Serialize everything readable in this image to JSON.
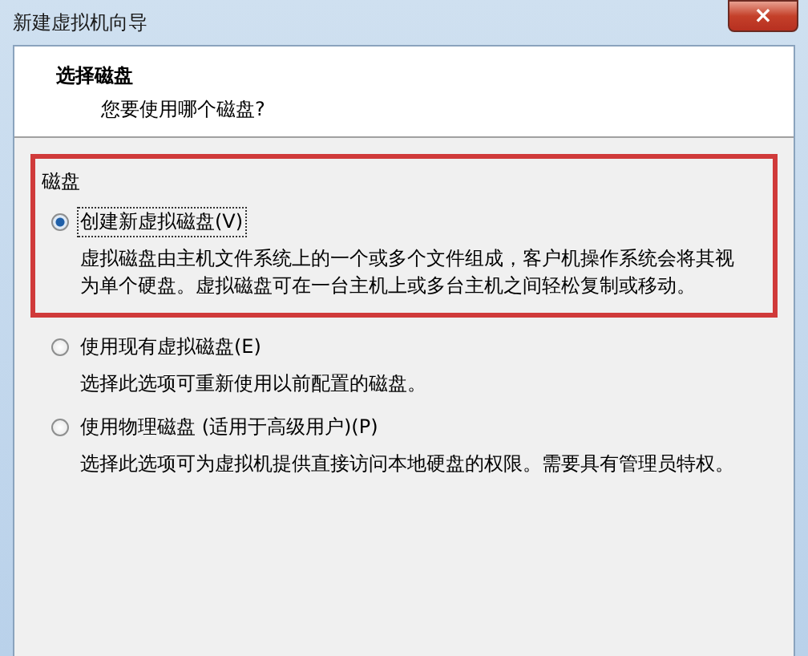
{
  "window": {
    "title": "新建虚拟机向导",
    "close": "×"
  },
  "header": {
    "title": "选择磁盘",
    "subtitle": "您要使用哪个磁盘?"
  },
  "group": {
    "label": "磁盘",
    "highlighted": true
  },
  "options": [
    {
      "label": "创建新虚拟磁盘(V)",
      "description": "虚拟磁盘由主机文件系统上的一个或多个文件组成，客户机操作系统会将其视为单个硬盘。虚拟磁盘可在一台主机上或多台主机之间轻松复制或移动。",
      "selected": true
    },
    {
      "label": "使用现有虚拟磁盘(E)",
      "description": "选择此选项可重新使用以前配置的磁盘。",
      "selected": false
    },
    {
      "label": "使用物理磁盘 (适用于高级用户)(P)",
      "description": "选择此选项可为虚拟机提供直接访问本地硬盘的权限。需要具有管理员特权。",
      "selected": false
    }
  ]
}
